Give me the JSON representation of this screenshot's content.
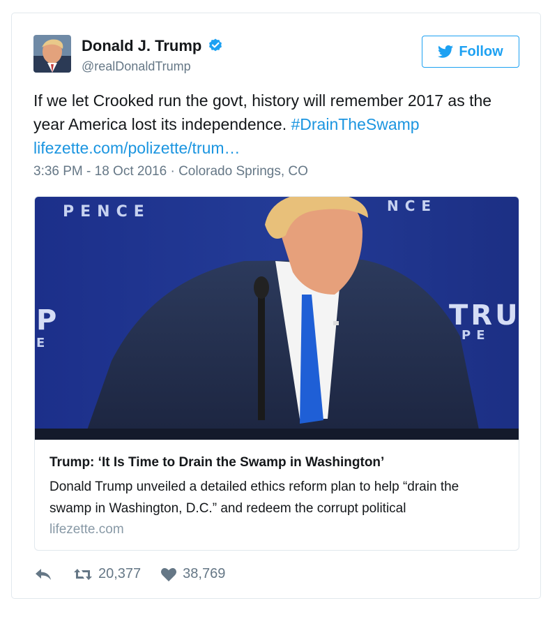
{
  "user": {
    "name": "Donald J. Trump",
    "handle": "@realDonaldTrump",
    "verified": true
  },
  "follow_label": "Follow",
  "tweet": {
    "text": "If we let Crooked run the govt, history will remember 2017 as the year America lost its independence.",
    "hashtag": "#DrainTheSwamp",
    "link": "lifezette.com/polizette/trum…",
    "timestamp": "3:36 PM - 18 Oct 2016",
    "separator": "·",
    "location": "Colorado Springs, CO"
  },
  "card": {
    "title": "Trump: ‘It Is Time to Drain the Swamp in Washington’",
    "description": "Donald Trump unveiled a detailed ethics reform plan to help “drain the swamp in Washington, D.C.” and redeem the corrupt political",
    "domain": "lifezette.com",
    "backdrop_text_left": "PENCE",
    "backdrop_text_right_top": "NCE",
    "backdrop_text_right": "TRU",
    "backdrop_text_right_sub": "PE",
    "backdrop_text_left_mid": "P",
    "backdrop_text_left_sub": "E"
  },
  "actions": {
    "reply_icon": "reply-icon",
    "retweet_icon": "retweet-icon",
    "retweet_count": "20,377",
    "like_icon": "heart-icon",
    "like_count": "38,769"
  },
  "colors": {
    "accent": "#1da1f2",
    "link": "#1b95e0",
    "meta": "#657786",
    "border": "#e1e8ed",
    "backdrop_blue": "#1f3a8a"
  }
}
